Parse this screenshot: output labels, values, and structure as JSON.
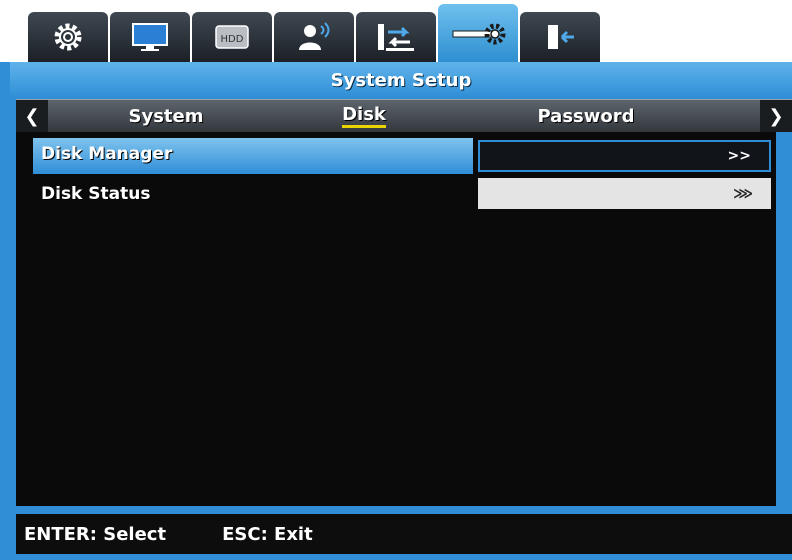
{
  "tabs": [
    {
      "icon": "gear-icon"
    },
    {
      "icon": "monitor-icon"
    },
    {
      "icon": "hdd-icon",
      "label": "HDD"
    },
    {
      "icon": "user-network-icon"
    },
    {
      "icon": "network-transfer-icon"
    },
    {
      "icon": "system-setup-icon",
      "active": true
    },
    {
      "icon": "exit-door-icon"
    }
  ],
  "title": "System Setup",
  "subnav": {
    "items": [
      "System",
      "Disk",
      "Password"
    ],
    "active": "Disk"
  },
  "rows": [
    {
      "label": "Disk Manager",
      "value": ">>",
      "selected": true
    },
    {
      "label": "Disk Status",
      "value": "⋙",
      "selected": false
    }
  ],
  "footer": {
    "enter": "ENTER: Select",
    "esc": "ESC: Exit"
  },
  "colors": {
    "accent": "#2f8ed6",
    "active_tab": "#5ab2ea",
    "underline": "#e8d400"
  }
}
